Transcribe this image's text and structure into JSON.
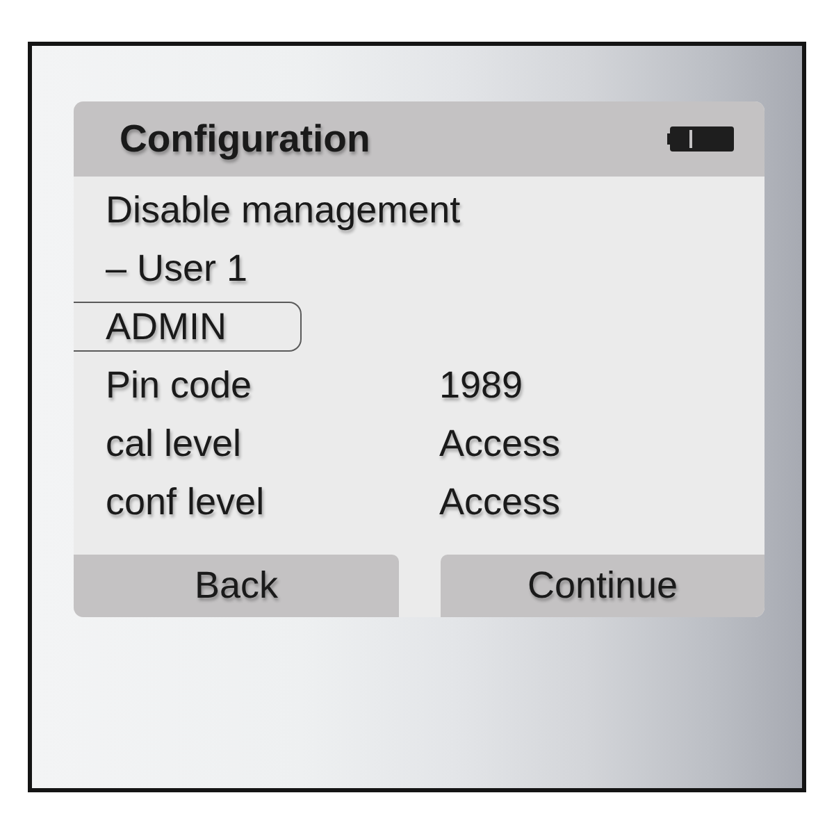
{
  "title_bar": {
    "title": "Configuration"
  },
  "rows": [
    {
      "label": "Disable management",
      "selected": false
    },
    {
      "label": "– User 1",
      "selected": false
    },
    {
      "label": "ADMIN",
      "selected": true
    },
    {
      "label": "Pin code",
      "value": "1989",
      "selected": false
    },
    {
      "label": "cal level",
      "value": "Access",
      "selected": false
    },
    {
      "label": "conf level",
      "value": "Access",
      "selected": false
    }
  ],
  "buttons": [
    {
      "label": "Back"
    },
    {
      "label": "Continue"
    }
  ]
}
